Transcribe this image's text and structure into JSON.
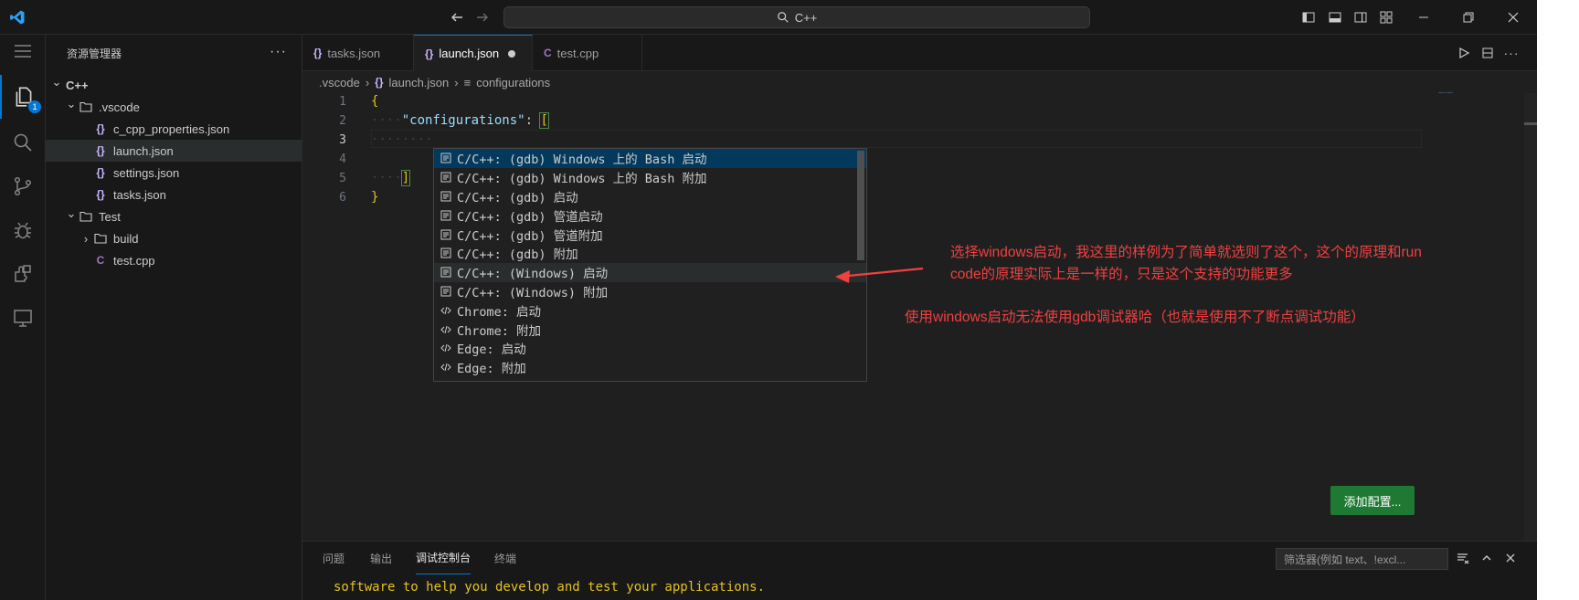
{
  "window": {
    "search_text": "C++"
  },
  "activity": {
    "explorer_badge": "1"
  },
  "sidebar": {
    "title": "资源管理器",
    "more": "···",
    "tree": [
      {
        "label": "C++",
        "depth": 0,
        "kind": "folder-root",
        "expanded": true
      },
      {
        "label": ".vscode",
        "depth": 1,
        "kind": "folder",
        "expanded": true
      },
      {
        "label": "c_cpp_properties.json",
        "depth": 2,
        "kind": "json"
      },
      {
        "label": "launch.json",
        "depth": 2,
        "kind": "json",
        "selected": true
      },
      {
        "label": "settings.json",
        "depth": 2,
        "kind": "json"
      },
      {
        "label": "tasks.json",
        "depth": 2,
        "kind": "json"
      },
      {
        "label": "Test",
        "depth": 1,
        "kind": "folder",
        "expanded": true
      },
      {
        "label": "build",
        "depth": 2,
        "kind": "folder",
        "expanded": false
      },
      {
        "label": "test.cpp",
        "depth": 2,
        "kind": "cpp"
      }
    ]
  },
  "tabs": [
    {
      "label": "tasks.json",
      "icon": "json-icon",
      "active": false
    },
    {
      "label": "launch.json",
      "icon": "json-icon",
      "active": true,
      "dirty": true
    },
    {
      "label": "test.cpp",
      "icon": "cpp-icon",
      "active": false
    }
  ],
  "breadcrumb": [
    ".vscode",
    "launch.json",
    "configurations"
  ],
  "editor": {
    "line_numbers": [
      "1",
      "2",
      "3",
      "4",
      "5",
      "6"
    ],
    "current_line": "3",
    "lines": {
      "l1_brace": "{",
      "l2_indent": "····",
      "l2_key": "\"configurations\"",
      "l2_colon": ": ",
      "l2_bracket": "[",
      "l3_indent": "········",
      "l5_indent": "····",
      "l5_bracket": "]",
      "l6_brace": "}"
    }
  },
  "suggestions": [
    {
      "label": "C/C++: (gdb) Windows 上的 Bash 启动",
      "icon": "snippet-icon"
    },
    {
      "label": "C/C++: (gdb) Windows 上的 Bash 附加",
      "icon": "snippet-icon"
    },
    {
      "label": "C/C++: (gdb) 启动",
      "icon": "snippet-icon"
    },
    {
      "label": "C/C++: (gdb) 管道启动",
      "icon": "snippet-icon"
    },
    {
      "label": "C/C++: (gdb) 管道附加",
      "icon": "snippet-icon"
    },
    {
      "label": "C/C++: (gdb) 附加",
      "icon": "snippet-icon"
    },
    {
      "label": "C/C++: (Windows) 启动",
      "icon": "snippet-icon"
    },
    {
      "label": "C/C++: (Windows) 附加",
      "icon": "snippet-icon"
    },
    {
      "label": "Chrome: 启动",
      "icon": "code-icon"
    },
    {
      "label": "Chrome: 附加",
      "icon": "code-icon"
    },
    {
      "label": "Edge: 启动",
      "icon": "code-icon"
    },
    {
      "label": "Edge: 附加",
      "icon": "code-icon"
    }
  ],
  "annotations": {
    "note1_line1": "选择windows启动，我这里的样例为了简单就选则了这个，这个的原理和run",
    "note1_line2": "code的原理实际上是一样的，只是这个支持的功能更多",
    "note2": "使用windows启动无法使用gdb调试器哈（也就是使用不了断点调试功能）",
    "color": "#f24040"
  },
  "add_config_label": "添加配置...",
  "panel": {
    "tabs": [
      "问题",
      "输出",
      "调试控制台",
      "终端"
    ],
    "active_tab": "调试控制台",
    "filter_placeholder": "筛选器(例如 text、!excl...",
    "console_text": "software to help you develop and test your applications."
  },
  "colors": {
    "accent": "#0078d4",
    "button": "#1e7a33",
    "string_key": "#9cdcfe",
    "bracket": "#e3c31c"
  }
}
